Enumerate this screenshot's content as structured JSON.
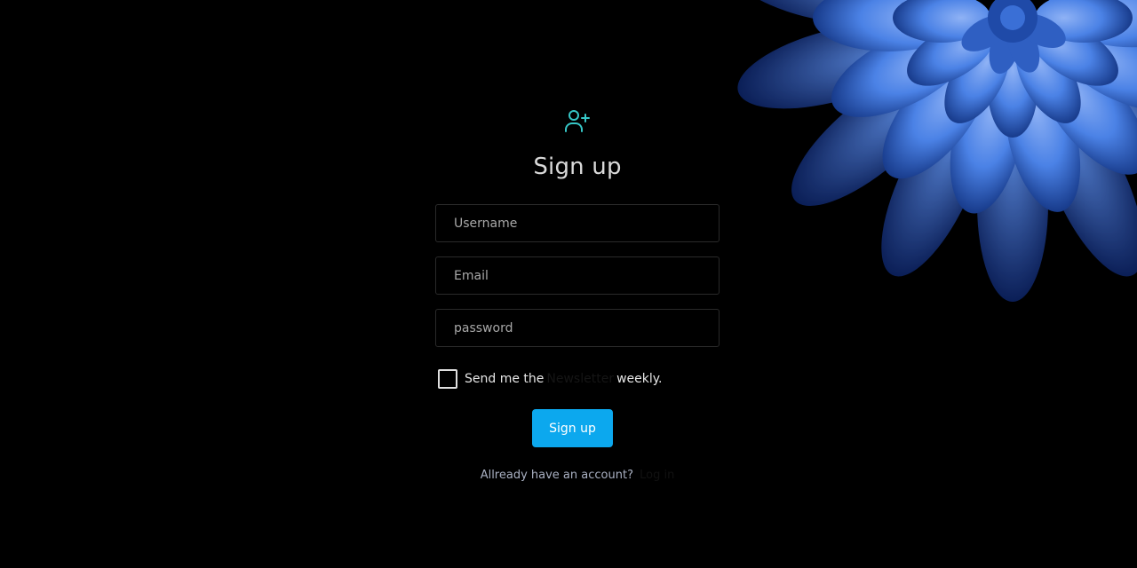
{
  "icon": "user-plus-icon",
  "title": "Sign up",
  "fields": {
    "username_placeholder": "Username",
    "email_placeholder": "Email",
    "password_placeholder": "password"
  },
  "newsletter": {
    "prefix": "Send me the",
    "link": "Newsletter",
    "suffix": "weekly."
  },
  "button_label": "Sign up",
  "login": {
    "prompt": "Allready have an account?",
    "link": "Log in"
  },
  "colors": {
    "background": "#000000",
    "accent": "#0ca8ee",
    "icon": "#36c6c6",
    "flower": "#3f7de0"
  }
}
